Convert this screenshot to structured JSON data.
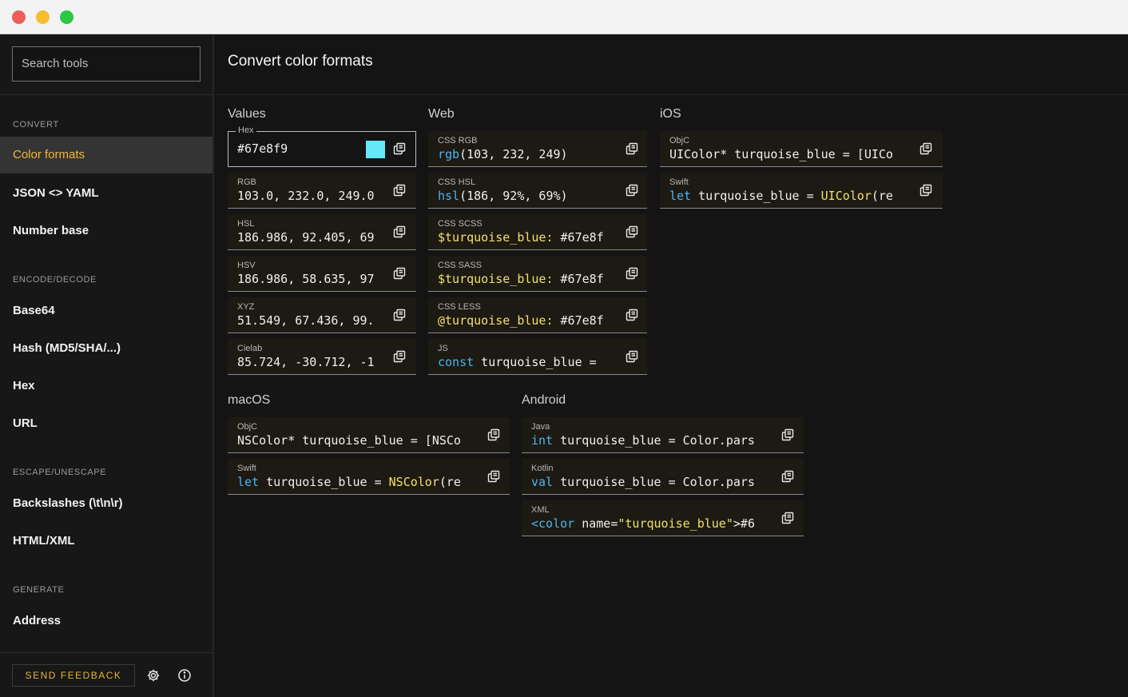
{
  "window": {
    "traffic_lights": [
      "#ed5f57",
      "#f5bd2f",
      "#2cc840"
    ]
  },
  "sidebar": {
    "search_placeholder": "Search tools",
    "sections": {
      "convert": "CONVERT",
      "encode": "ENCODE/DECODE",
      "escape": "ESCAPE/UNESCAPE",
      "generate": "GENERATE"
    },
    "items": {
      "color_formats": "Color formats",
      "json_yaml": "JSON <> YAML",
      "number_base": "Number base",
      "base64": "Base64",
      "hash": "Hash (MD5/SHA/...)",
      "hex": "Hex",
      "url": "URL",
      "backslashes": "Backslashes (\\t\\n\\r)",
      "html_xml": "HTML/XML",
      "address": "Address"
    },
    "feedback_label": "SEND FEEDBACK",
    "accent": "#f0b93a"
  },
  "main": {
    "title": "Convert color formats",
    "groups": {
      "values": "Values",
      "web": "Web",
      "ios": "iOS",
      "macos": "macOS",
      "android": "Android"
    },
    "values": {
      "hex": {
        "label": "Hex",
        "value": "#67e8f9",
        "swatch": "#67e8f9"
      },
      "rgb": {
        "label": "RGB",
        "value": "103.0, 232.0, 249.0"
      },
      "hsl": {
        "label": "HSL",
        "value": "186.986, 92.405, 69"
      },
      "hsv": {
        "label": "HSV",
        "value": "186.986, 58.635, 97"
      },
      "xyz": {
        "label": "XYZ",
        "value": "51.549, 67.436, 99."
      },
      "cielab": {
        "label": "Cielab",
        "value": "85.724, -30.712, -1"
      }
    },
    "web": {
      "css_rgb": {
        "label": "CSS RGB",
        "a": "rgb",
        "b": "(103, 232, 249)"
      },
      "css_hsl": {
        "label": "CSS HSL",
        "a": "hsl",
        "b": "(186, 92%, 69%)"
      },
      "css_scss": {
        "label": "CSS SCSS",
        "a": "$turquoise_blue:",
        "b": " #67e8f"
      },
      "css_sass": {
        "label": "CSS SASS",
        "a": "$turquoise_blue:",
        "b": " #67e8f"
      },
      "css_less": {
        "label": "CSS LESS",
        "a": "@turquoise_blue:",
        "b": " #67e8f"
      },
      "js": {
        "label": "JS",
        "a": "const",
        "b": " turquoise_blue ="
      }
    },
    "ios": {
      "objc": {
        "label": "ObjC",
        "value": "UIColor* turquoise_blue = [UICo"
      },
      "swift": {
        "label": "Swift",
        "a": "let",
        "b": " turquoise_blue = ",
        "c": "UIColor",
        "d": "(re"
      }
    },
    "macos": {
      "objc": {
        "label": "ObjC",
        "value": "NSColor* turquoise_blue = [NSCo"
      },
      "swift": {
        "label": "Swift",
        "a": "let",
        "b": " turquoise_blue = ",
        "c": "NSColor",
        "d": "(re"
      }
    },
    "android": {
      "java": {
        "label": "Java",
        "a": "int",
        "b": " turquoise_blue = Color.pars"
      },
      "kotlin": {
        "label": "Kotlin",
        "a": "val",
        "b": " turquoise_blue = Color.pars"
      },
      "xml": {
        "label": "XML",
        "a": "<color",
        "b": " name=",
        "c": "\"turquoise_blue\"",
        "d": ">#6"
      }
    }
  },
  "icons": {
    "copy": "copy-icon",
    "settings": "gear-icon",
    "info": "info-icon"
  }
}
